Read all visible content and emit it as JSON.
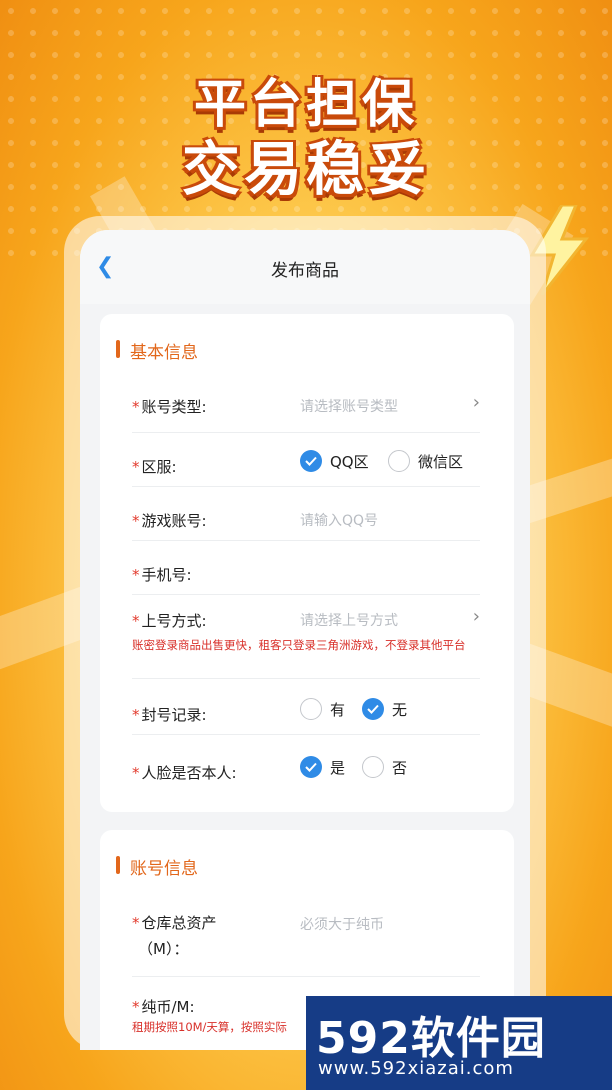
{
  "headline": {
    "line1": "平台担保",
    "line2": "交易稳妥"
  },
  "navbar": {
    "back_icon": "chevron-left-icon",
    "title": "发布商品"
  },
  "basic": {
    "title": "基本信息",
    "account_type": {
      "label": "账号类型:",
      "placeholder": "请选择账号类型"
    },
    "server": {
      "label": "区服:",
      "options": [
        {
          "label": "QQ区",
          "checked": true
        },
        {
          "label": "微信区",
          "checked": false
        }
      ]
    },
    "game_account": {
      "label": "游戏账号:",
      "placeholder": "请输入QQ号"
    },
    "phone": {
      "label": "手机号:"
    },
    "login_method": {
      "label": "上号方式:",
      "placeholder": "请选择上号方式",
      "note": "账密登录商品出售更快，租客只登录三角洲游戏，不登录其他平台"
    },
    "ban_record": {
      "label": "封号记录:",
      "options": [
        {
          "label": "有",
          "checked": false
        },
        {
          "label": "无",
          "checked": true
        }
      ]
    },
    "face": {
      "label": "人脸是否本人:",
      "options": [
        {
          "label": "是",
          "checked": true
        },
        {
          "label": "否",
          "checked": false
        }
      ]
    }
  },
  "account": {
    "title": "账号信息",
    "total_assets": {
      "label_line1": "仓库总资产",
      "label_line2": "（M）：",
      "placeholder": "必须大于纯币"
    },
    "coins": {
      "label": "纯币/M:",
      "note": "租期按照10M/天算，按照实际"
    }
  },
  "watermark": {
    "brand": "592软件园",
    "url": "www.592xiazai.com"
  },
  "colors": {
    "accent": "#2f8be6",
    "section": "#e2671b",
    "required": "#e23b2e"
  }
}
